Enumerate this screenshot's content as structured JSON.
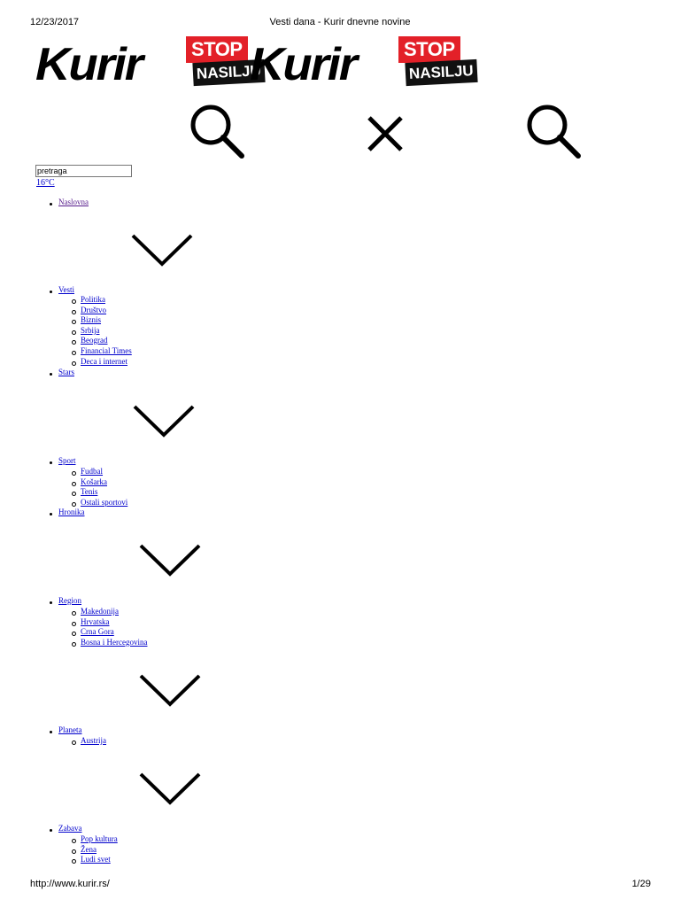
{
  "browser": {
    "date": "12/23/2017",
    "title": "Vesti dana - Kurir dnevne novine",
    "url": "http://www.kurir.rs/",
    "page": "1/29"
  },
  "logo": {
    "word": "Kurir",
    "stop": "STOP",
    "nasilju": "NASILJU"
  },
  "search": {
    "value": "pretraga"
  },
  "weather": "16°C",
  "nav": {
    "naslovna": "Naslovna",
    "vesti": "Vesti",
    "vesti_sub": [
      "Politika",
      "Društvo",
      "Biznis",
      "Srbija",
      "Beograd",
      "Financial Times",
      "Deca i internet"
    ],
    "stars": "Stars",
    "sport": "Sport",
    "sport_sub": [
      "Fudbal",
      "Košarka",
      "Tenis",
      "Ostali sportovi"
    ],
    "hronika": "Hronika",
    "region": "Region",
    "region_sub": [
      "Makedonija",
      "Hrvatska",
      "Crna Gora",
      "Bosna i Hercegovina"
    ],
    "planeta": "Planeta",
    "planeta_sub": [
      "Austrija"
    ],
    "zabava": "Zabava",
    "zabava_sub": [
      "Pop kultura",
      "Žena",
      "Ludi svet"
    ]
  },
  "icons": [
    "search-icon",
    "close-icon",
    "chevron-down-icon"
  ]
}
